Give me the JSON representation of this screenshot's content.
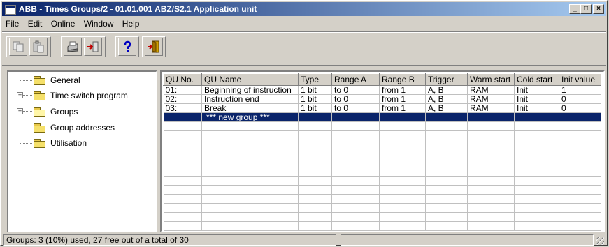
{
  "window": {
    "title": "ABB - Times Groups/2 - 01.01.001 ABZ/S2.1 Application unit",
    "minimize_label": "_",
    "maximize_label": "□",
    "close_label": "×"
  },
  "menu": [
    {
      "label": "File"
    },
    {
      "label": "Edit"
    },
    {
      "label": "Online"
    },
    {
      "label": "Window"
    },
    {
      "label": "Help"
    }
  ],
  "toolbar": {
    "buttons": [
      "copy-icon",
      "paste-icon",
      "print-icon",
      "import-icon",
      "help-icon",
      "exit-icon"
    ]
  },
  "tree": {
    "items": [
      {
        "label": "General"
      },
      {
        "label": "Time switch program"
      },
      {
        "label": "Groups"
      },
      {
        "label": "Group addresses"
      },
      {
        "label": "Utilisation"
      }
    ]
  },
  "grid": {
    "columns": [
      "QU No.",
      "QU Name",
      "Type",
      "Range A",
      "Range B",
      "Trigger",
      "Warm start",
      "Cold start",
      "Init value"
    ],
    "rows": [
      [
        "01:",
        "Beginning of instruction",
        "1 bit",
        "to 0",
        "from 1",
        "A, B",
        "RAM",
        "Init",
        "1"
      ],
      [
        "02:",
        "Instruction end",
        "1 bit",
        "to 0",
        "from 1",
        "A, B",
        "RAM",
        "Init",
        "0"
      ],
      [
        "03:",
        "Break",
        "1 bit",
        "to 0",
        "from 1",
        "A, B",
        "RAM",
        "Init",
        "0"
      ]
    ],
    "new_row_label": "*** new group ***"
  },
  "status": {
    "text": "Groups: 3 (10%) used, 27 free out of a total of 30"
  },
  "colors": {
    "title_gradient_start": "#0a246a",
    "selection": "#0a246a",
    "face": "#d4d0c8"
  }
}
